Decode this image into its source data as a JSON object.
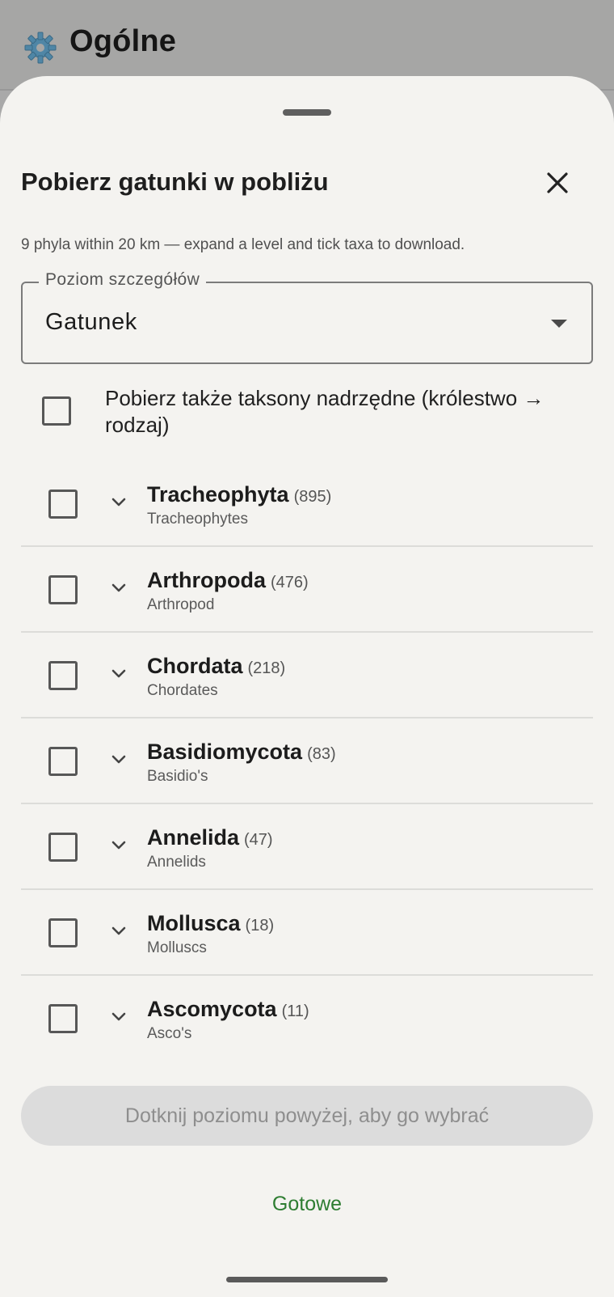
{
  "app_bar": {
    "icon": "gear-icon",
    "title": "Ogólne"
  },
  "sheet": {
    "title": "Pobierz gatunki w pobliżu",
    "subtitle": "9 phyla within 20 km — expand a level and tick taxa to download.",
    "level_field": {
      "label": "Poziom szczegółów",
      "value": "Gatunek"
    },
    "include_ancestors": {
      "label": "Pobierz także taksony nadrzędne (królestwo → rodzaj)",
      "checked": false
    },
    "taxa": [
      {
        "name": "Tracheophyta",
        "count": "(895)",
        "common": "Tracheophytes"
      },
      {
        "name": "Arthropoda",
        "count": "(476)",
        "common": "Arthropod"
      },
      {
        "name": "Chordata",
        "count": "(218)",
        "common": "Chordates"
      },
      {
        "name": "Basidiomycota",
        "count": "(83)",
        "common": "Basidio's"
      },
      {
        "name": "Annelida",
        "count": "(47)",
        "common": "Annelids"
      },
      {
        "name": "Mollusca",
        "count": "(18)",
        "common": "Molluscs"
      },
      {
        "name": "Ascomycota",
        "count": "(11)",
        "common": "Asco's"
      }
    ],
    "pick_level_button": "Dotknij poziomu powyżej, aby go wybrać",
    "done_button": "Gotowe"
  },
  "colors": {
    "scrim": "#a6a6a5",
    "sheet_bg": "#f4f3f0",
    "accent_green": "#2e7d32",
    "disabled_button_bg": "#dcdcdc",
    "disabled_button_text": "#8e8e8e"
  }
}
